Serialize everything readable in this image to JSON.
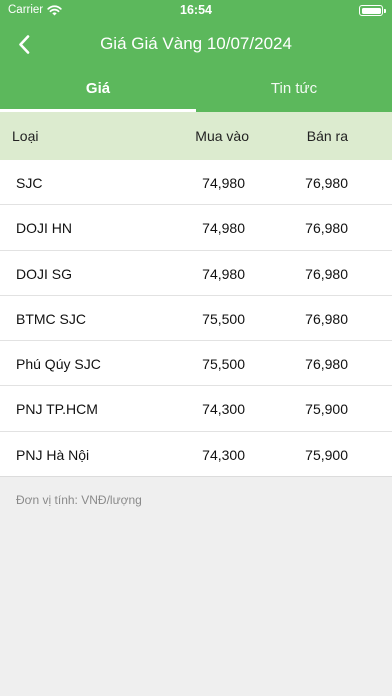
{
  "status_bar": {
    "carrier": "Carrier",
    "time": "16:54"
  },
  "nav": {
    "title": "Giá Giá Vàng 10/07/2024"
  },
  "tabs": [
    {
      "label": "Giá",
      "active": true
    },
    {
      "label": "Tin tức",
      "active": false
    }
  ],
  "table": {
    "headers": {
      "type": "Loại",
      "buy": "Mua vào",
      "sell": "Bán ra"
    },
    "rows": [
      {
        "type": "SJC",
        "buy": "74,980",
        "sell": "76,980"
      },
      {
        "type": "DOJI HN",
        "buy": "74,980",
        "sell": "76,980"
      },
      {
        "type": "DOJI SG",
        "buy": "74,980",
        "sell": "76,980"
      },
      {
        "type": "BTMC SJC",
        "buy": "75,500",
        "sell": "76,980"
      },
      {
        "type": "Phú Qúy SJC",
        "buy": "75,500",
        "sell": "76,980"
      },
      {
        "type": "PNJ TP.HCM",
        "buy": "74,300",
        "sell": "75,900"
      },
      {
        "type": "PNJ Hà Nội",
        "buy": "74,300",
        "sell": "75,900"
      }
    ]
  },
  "footer": {
    "unit_note": "Đơn vị tính: VNĐ/lượng"
  },
  "colors": {
    "primary": "#5cb85c",
    "header_row": "#dcebcf",
    "background": "#efefef"
  }
}
